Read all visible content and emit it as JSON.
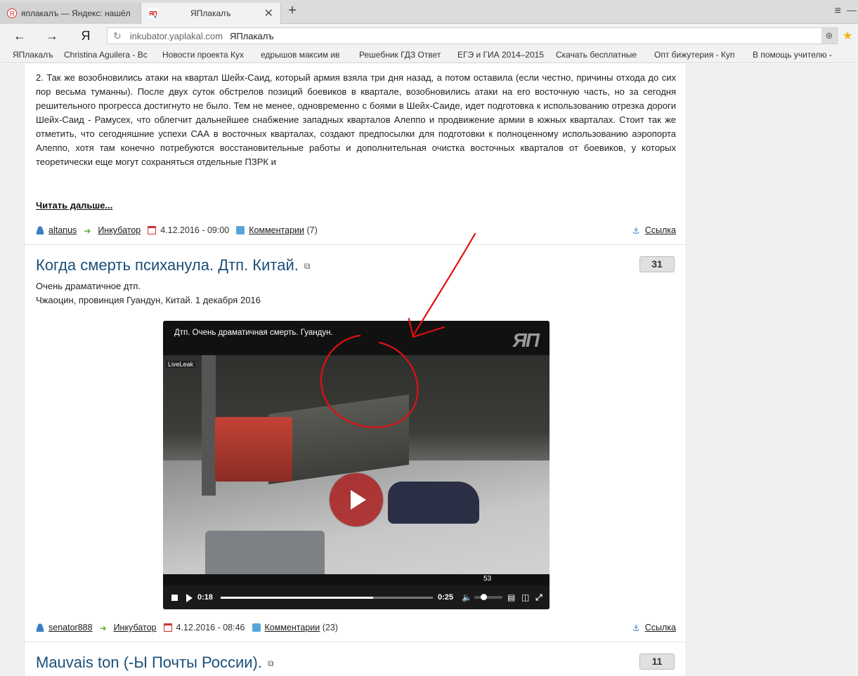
{
  "browser": {
    "tabs": [
      {
        "title": "яплакалъ — Яндекс: нашёл",
        "favicon": "yandex-icon",
        "active": false
      },
      {
        "title": "ЯПлакалъ",
        "favicon": "yaplakal-icon",
        "active": true
      }
    ],
    "new_tab": "+",
    "menu": "≡",
    "minimize": "—",
    "nav": {
      "back": "←",
      "forward": "→",
      "yandex": "Я",
      "reload": "↻"
    },
    "url": {
      "domain": "inkubator.yaplakal.com",
      "page_title": "ЯПлакалъ"
    },
    "star": "★",
    "bookmarks": [
      "ЯПлакалъ",
      "Christina Aguilera - Вс",
      "Новости проекта Кух",
      "едрышов максим ив",
      "Решебник ГДЗ Ответ",
      "ЕГЭ и ГИА 2014–2015",
      "Скачать бесплатные",
      "Опт бижутерия - Куп",
      "В помощь учителю -"
    ]
  },
  "post1": {
    "text": "2. Так же возобновились атаки на квартал Шейх-Саид, который армия взяла три дня назад, а потом оставила (если честно, причины отхода до сих пор весьма туманны). После двух суток обстрелов позиций боевиков в квартале, возобновились атаки на его восточную часть, но за сегодня решительного прогресса достигнуто не было. Тем не менее, одновременно с боями в Шейх-Саиде, идет подготовка к использованию отрезка дороги Шейх-Саид - Рамусех, что облегчит дальнейшее снабжение западных кварталов Алеппо и продвижение армии в южных кварталах. Стоит так же отметить, что сегодняшние успехи САА в восточных кварталах, создают предпосылки для подготовки к полноценному использованию аэропорта Алеппо, хотя там конечно потребуются восстановительные работы и дополнительная очистка восточных кварталов от боевиков, у которых теоретически еще могут сохраняться отдельные ПЗРК и",
    "read_more": "Читать дальше...",
    "meta": {
      "author": "altanus",
      "section": "Инкубатор",
      "date": "4.12.2016 - 09:00",
      "comments": "Комментарии",
      "comments_count": "(7)",
      "link": "Ссылка"
    }
  },
  "post2": {
    "title": "Когда смерть психанула. Дтп. Китай.",
    "rating": "31",
    "desc_line1": "Очень драматичное дтп.",
    "desc_line2": "Чжаоцин, провинция Гуандун, Китай. 1 декабря 2016",
    "video": {
      "title": "Дтп. Очень драматичная смерть. Гуандун.",
      "logo": "ЯП",
      "source_tag": "LiveLeak",
      "elapsed": "0:18",
      "duration": "0:25",
      "progress": 0.72,
      "volume_tooltip": "53",
      "volume": 0.53
    },
    "meta": {
      "author": "senator888",
      "section": "Инкубатор",
      "date": "4.12.2016 - 08:46",
      "comments": "Комментарии",
      "comments_count": "(23)",
      "link": "Ссылка"
    }
  },
  "post3": {
    "title": "Mauvais ton (-Ы Почты России).",
    "rating": "11"
  },
  "colors": {
    "title": "#1c4f7a",
    "annotation": "#e01010",
    "star": "#f0b400"
  }
}
